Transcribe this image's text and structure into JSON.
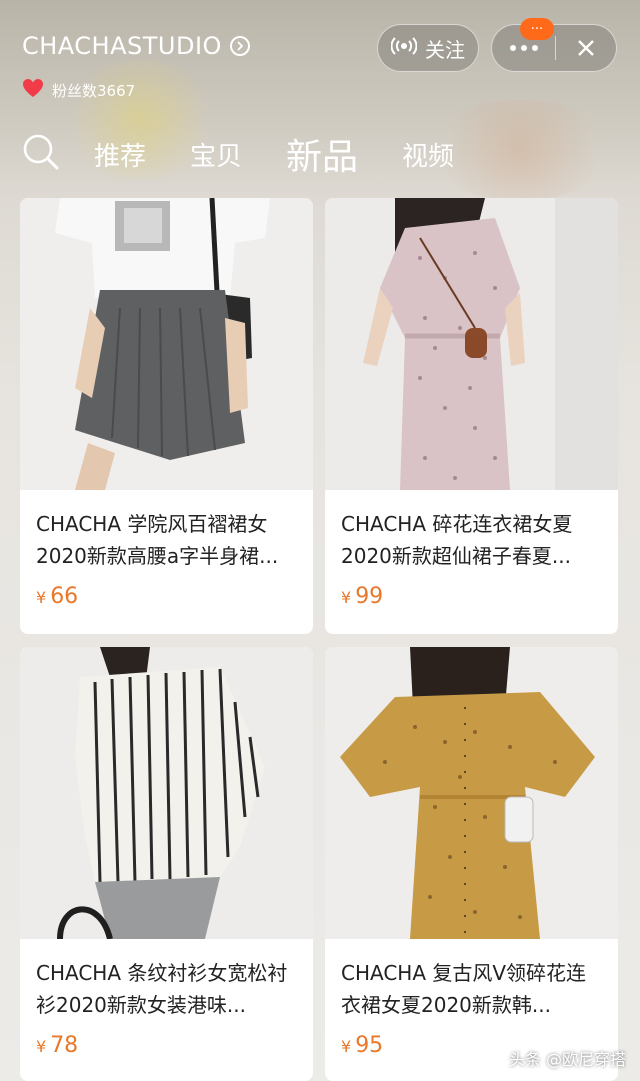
{
  "header": {
    "store_name": "CHACHASTUDIO",
    "fans_text": "粉丝数3667",
    "follow_label": "关注",
    "more_badge": "···"
  },
  "tabs": [
    {
      "label": "推荐",
      "active": false
    },
    {
      "label": "宝贝",
      "active": false
    },
    {
      "label": "新品",
      "active": true
    },
    {
      "label": "视频",
      "active": false
    }
  ],
  "products": [
    {
      "title": "CHACHA 学院风百褶裙女2020新款高腰a字半身裙...",
      "price": "66",
      "currency": "¥"
    },
    {
      "title": "CHACHA 碎花连衣裙女夏2020新款超仙裙子春夏...",
      "price": "99",
      "currency": "¥"
    },
    {
      "title": "CHACHA 条纹衬衫女宽松衬衫2020新款女装港味...",
      "price": "78",
      "currency": "¥"
    },
    {
      "title": "CHACHA 复古风V领碎花连衣裙女夏2020新款韩...",
      "price": "95",
      "currency": "¥"
    }
  ],
  "colors": {
    "price": "#e8782a",
    "badge": "#ff6a1a"
  },
  "watermark": "头条 @欧尼穿搭"
}
